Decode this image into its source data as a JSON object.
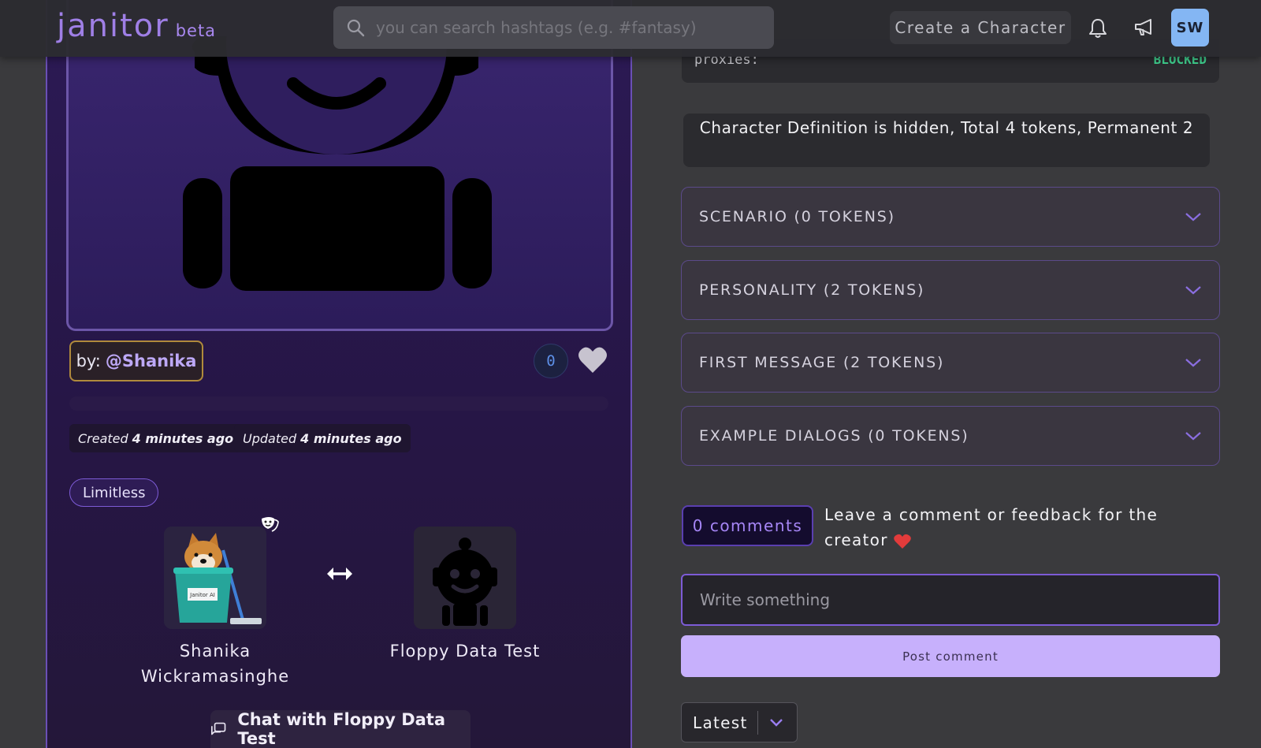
{
  "header": {
    "logo": "janitor",
    "logo_badge": "beta",
    "search_placeholder": "you can search hashtags (e.g. #fantasy)",
    "create_label": "Create a Character",
    "avatar_initials": "SW"
  },
  "character": {
    "by_prefix": "by:",
    "creator": "@Shanika",
    "like_count": "0",
    "created_prefix": "Created",
    "created_value": "4 minutes ago",
    "updated_prefix": "Updated",
    "updated_value": "4 minutes ago",
    "tag": "Limitless",
    "persona_name": "Shanika Wickramasinghe",
    "bot_name": "Floppy Data Test",
    "chat_button": "Chat with Floppy Data Test"
  },
  "details": {
    "proxies_label": "proxies:",
    "proxies_status": "BLOCKED",
    "definition_notice": "Character Definition is hidden, Total 4 tokens, Permanent 2",
    "sections": [
      {
        "label": "SCENARIO (0 TOKENS)"
      },
      {
        "label": "PERSONALITY (2 TOKENS)"
      },
      {
        "label": "FIRST MESSAGE (2 TOKENS)"
      },
      {
        "label": "EXAMPLE DIALOGS (0 TOKENS)"
      }
    ]
  },
  "comments": {
    "count_label": "0 comments",
    "prompt": "Leave a comment or feedback for the creator",
    "input_placeholder": "Write something",
    "post_button": "Post comment",
    "sort_selected": "Latest"
  },
  "colors": {
    "accent": "#9f7fe6",
    "post_button": "#c7b0fc",
    "blocked_status": "#3fcf8e",
    "creator_border": "#b08a3c"
  }
}
